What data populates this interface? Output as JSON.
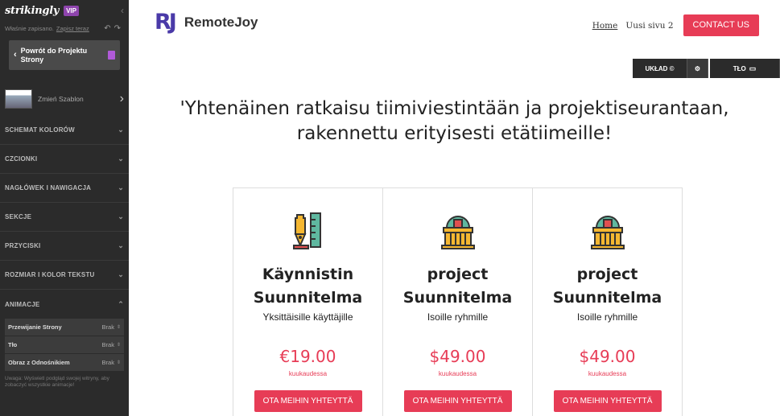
{
  "sidebar": {
    "logo": "strikingly",
    "vip": "VIP",
    "saved_text": "Właśnie zapisano.",
    "save_now": "Zapisz teraz",
    "back_label": "Powrót do Projektu Strony",
    "change_template": "Zmień Szablon",
    "sections": [
      {
        "label": "SCHEMAT KOLORÓW"
      },
      {
        "label": "CZCIONKI"
      },
      {
        "label": "NAGŁÓWEK I NAWIGACJA"
      },
      {
        "label": "SEKCJE"
      },
      {
        "label": "PRZYCISKI"
      },
      {
        "label": "ROZMIAR I KOLOR TEKSTU"
      },
      {
        "label": "ANIMACJE"
      }
    ],
    "animations": [
      {
        "label": "Przewijanie Strony",
        "value": "Brak"
      },
      {
        "label": "Tło",
        "value": "Brak"
      },
      {
        "label": "Obraz z Odnośnikiem",
        "value": "Brak"
      }
    ],
    "hint": "Uwaga: Wyświetl podgląd swojej witryny, aby zobaczyć wszystkie animacje!"
  },
  "site": {
    "brand_mark": "RJ",
    "brand_name": "RemoteJoy",
    "nav": {
      "home": "Home",
      "page2": "Uusi sivu 2",
      "contact": "CONTACT US"
    },
    "layout_bar": {
      "layout": "UKŁAD ©",
      "background": "TŁO"
    },
    "headline_1": "'Yhtenäinen ratkaisu tiimiviestintään ja projektiseurantaan,",
    "headline_2": "rakennettu erityisesti etätiimeille!",
    "plans": [
      {
        "title_1": "Käynnistin",
        "title_2": "Suunnitelma",
        "subtitle": "Yksittäisille käyttäjille",
        "price": "€19.00",
        "period": "kuukaudessa",
        "cta": "OTA MEIHIN YHTEYTTÄ",
        "icon": "drafting-tools-icon"
      },
      {
        "title_1": "project",
        "title_2": "Suunnitelma",
        "subtitle": "Isoille ryhmille",
        "price": "$49.00",
        "period": "kuukaudessa",
        "cta": "OTA MEIHIN YHTEYTTÄ",
        "icon": "building-icon"
      },
      {
        "title_1": "project",
        "title_2": "Suunnitelma",
        "subtitle": "Isoille ryhmille",
        "price": "$49.00",
        "period": "kuukaudessa",
        "cta": "OTA MEIHIN YHTEYTTÄ",
        "icon": "building-icon"
      }
    ]
  },
  "colors": {
    "accent": "#e73c56",
    "brand": "#4a3aa8",
    "sidebar": "#2b2b2b"
  }
}
